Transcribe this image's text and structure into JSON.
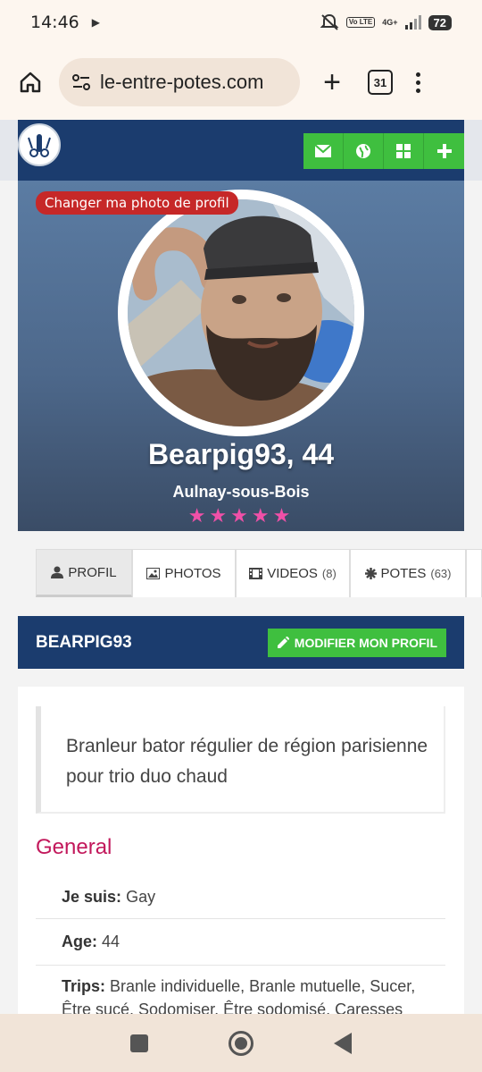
{
  "status_bar": {
    "time": "14:46",
    "volte": "Vo LTE",
    "network": "4G+",
    "battery": "72"
  },
  "browser": {
    "url": "le-entre-potes.com",
    "tab_count": "31"
  },
  "profile": {
    "change_photo_label": "Changer ma photo de profil",
    "name": "Bearpig93, 44",
    "city": "Aulnay-sous-Bois",
    "stars": "★★★★★",
    "rating": 5
  },
  "tabs": [
    {
      "label": "PROFIL",
      "count": ""
    },
    {
      "label": "PHOTOS",
      "count": ""
    },
    {
      "label": "VIDEOS",
      "count": "(8)"
    },
    {
      "label": "POTES",
      "count": "(63)"
    }
  ],
  "section": {
    "title": "BEARPIG93",
    "edit_label": "MODIFIER MON PROFIL"
  },
  "about": {
    "quote": "Branleur bator régulier de région parisienne pour trio duo chaud",
    "general_heading": "General",
    "rows": [
      {
        "label": "Je suis:",
        "value": "Gay"
      },
      {
        "label": "Age:",
        "value": "44"
      },
      {
        "label": "Trips:",
        "value": "Branle individuelle, Branle mutuelle, Sucer, Être sucé, Sodomiser, Être sodomisé, Caresses"
      }
    ]
  },
  "colors": {
    "navy": "#1b3c6e",
    "green": "#3fbf3f",
    "red": "#c62828",
    "pink_stars": "#f050a8",
    "general_heading": "#c2185b"
  }
}
